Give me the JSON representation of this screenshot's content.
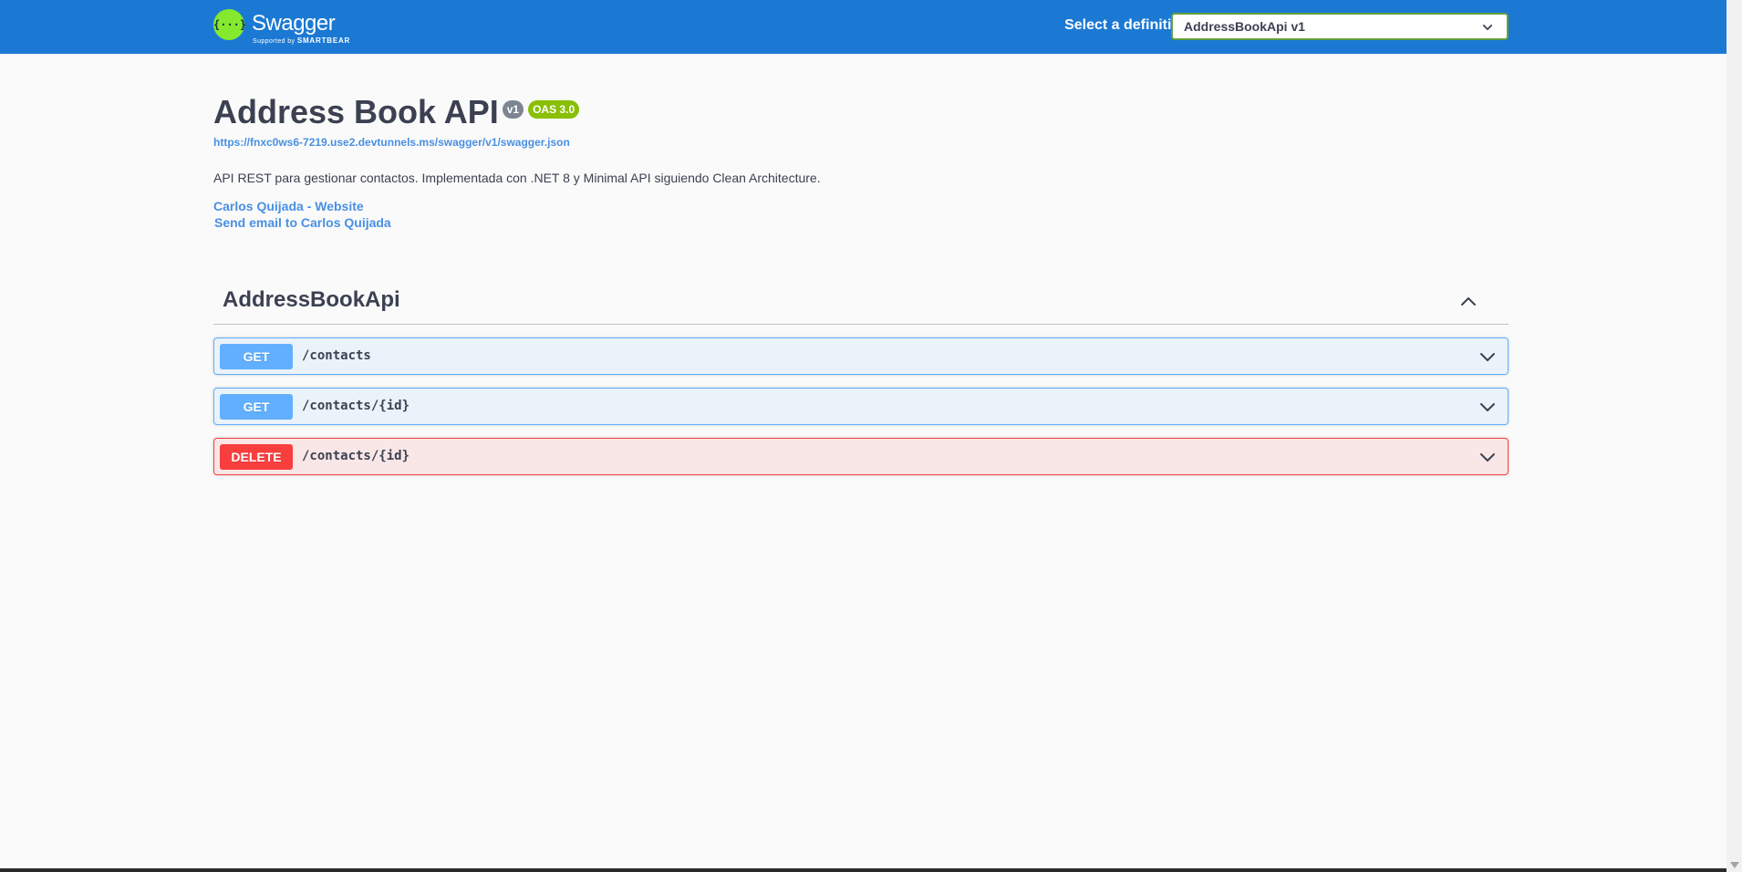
{
  "topbar": {
    "logo_name": "Swagger",
    "logo_sub_prefix": "Supported by",
    "logo_sub_brand": "SMARTBEAR",
    "logo_glyph": "{···}",
    "definition_label": "Select a definition",
    "definition_selected": "AddressBookApi v1"
  },
  "info": {
    "title": "Address Book API",
    "version_badge": "v1",
    "oas_badge": "OAS 3.0",
    "spec_url": "https://fnxc0ws6-7219.use2.devtunnels.ms/swagger/v1/swagger.json",
    "description": "API REST para gestionar contactos. Implementada con .NET 8 y Minimal API siguiendo Clean Architecture.",
    "contact_website": "Carlos Quijada - Website",
    "contact_email": "Send email to Carlos Quijada"
  },
  "tag": {
    "name": "AddressBookApi",
    "operations": [
      {
        "method": "GET",
        "path": "/contacts"
      },
      {
        "method": "GET",
        "path": "/contacts/{id}"
      },
      {
        "method": "DELETE",
        "path": "/contacts/{id}"
      }
    ]
  },
  "colors": {
    "topbar": "#1b79d4",
    "get": "#61affe",
    "delete": "#f93e3e",
    "oas_badge": "#89bf04",
    "version_badge": "#7d8492",
    "link": "#4990e2"
  }
}
